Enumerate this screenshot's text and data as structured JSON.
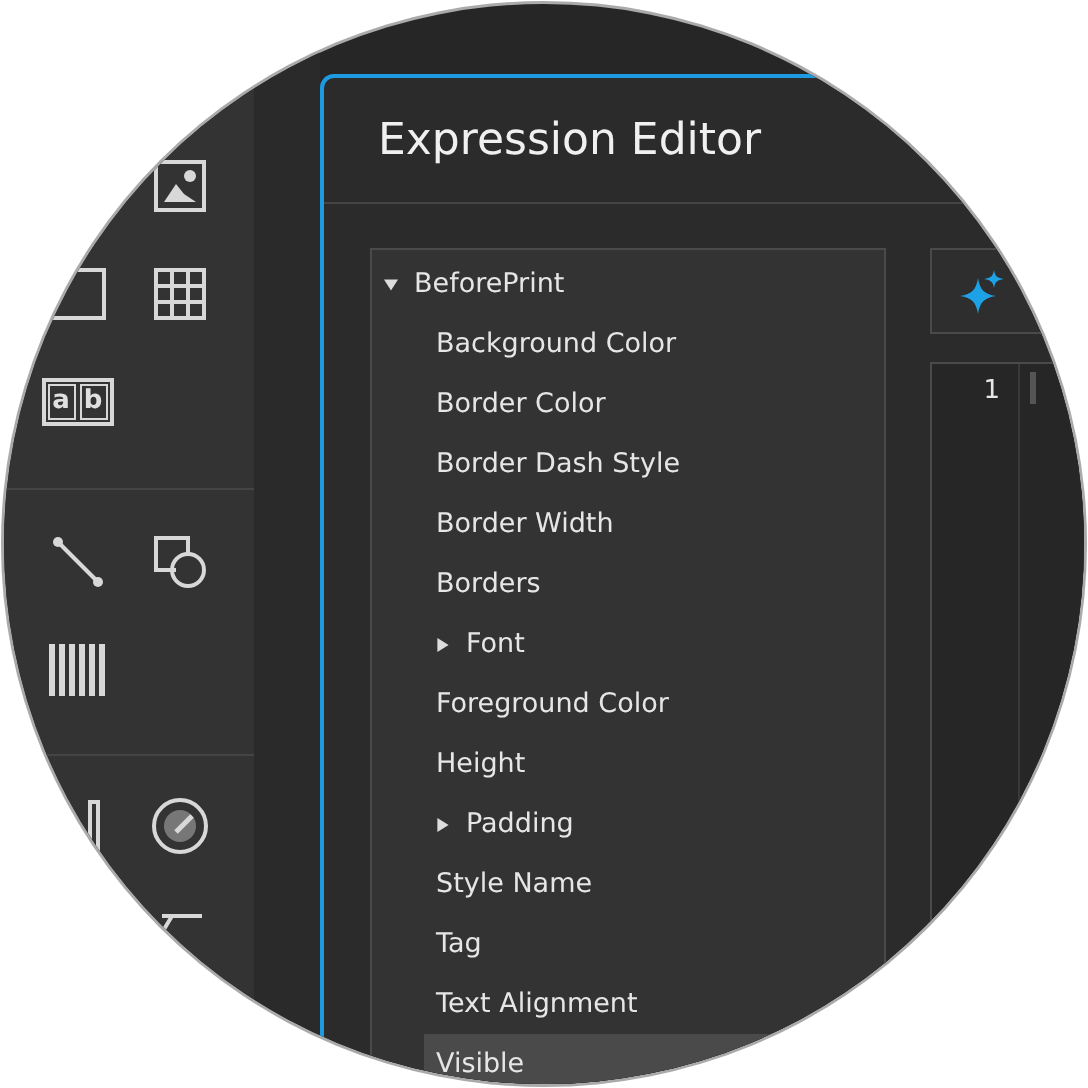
{
  "toolbox": {
    "groups": [
      {
        "rows": [
          [
            {
              "kind": "picture"
            }
          ],
          [
            {
              "kind": "frame"
            },
            {
              "kind": "table"
            }
          ],
          [
            {
              "kind": "letters",
              "letters": [
                "a",
                "b"
              ]
            }
          ]
        ]
      },
      {
        "rows": [
          [
            {
              "kind": "line"
            },
            {
              "kind": "shape"
            }
          ],
          [
            {
              "kind": "barcode"
            }
          ]
        ]
      },
      {
        "rows": [
          [
            {
              "kind": "bar"
            },
            {
              "kind": "gauge"
            }
          ],
          [
            {
              "kind": "angle"
            }
          ]
        ]
      }
    ]
  },
  "dialog": {
    "title": "Expression Editor",
    "tree": [
      {
        "label": "BeforePrint",
        "expanded": true,
        "selected": false,
        "children": [
          {
            "label": "Background Color",
            "selected": false
          },
          {
            "label": "Border Color",
            "selected": false
          },
          {
            "label": "Border Dash Style",
            "selected": false
          },
          {
            "label": "Border Width",
            "selected": false
          },
          {
            "label": "Borders",
            "selected": false
          },
          {
            "label": "Font",
            "expanded": false,
            "selected": false
          },
          {
            "label": "Foreground Color",
            "selected": false
          },
          {
            "label": "Height",
            "selected": false
          },
          {
            "label": "Padding",
            "expanded": false,
            "selected": false
          },
          {
            "label": "Style Name",
            "selected": false
          },
          {
            "label": "Tag",
            "selected": false
          },
          {
            "label": "Text Alignment",
            "selected": false
          },
          {
            "label": "Visible",
            "selected": true
          }
        ]
      }
    ],
    "editor": {
      "line_numbers": [
        "1"
      ]
    }
  }
}
